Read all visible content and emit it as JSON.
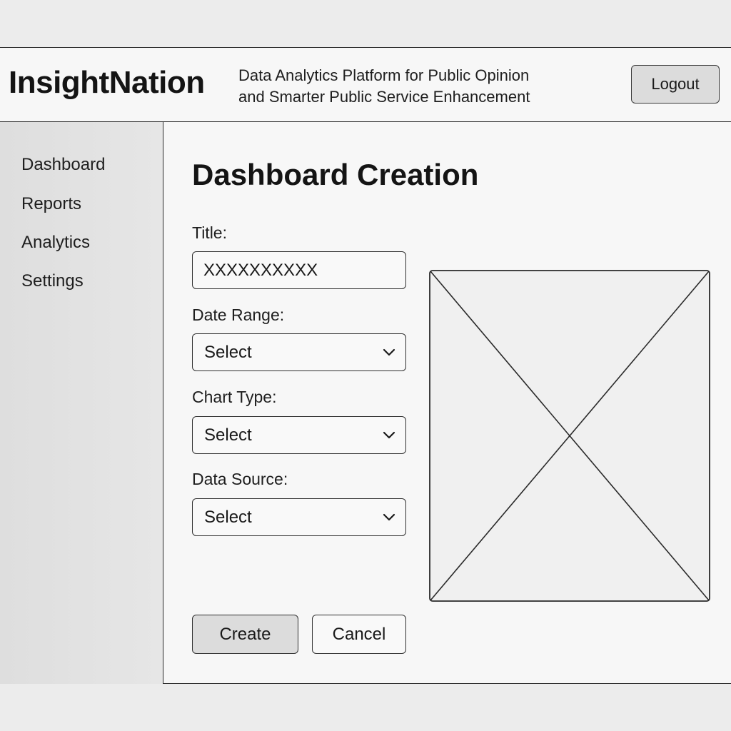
{
  "header": {
    "brand": "InsightNation",
    "tagline_line1": "Data Analytics Platform for Public Opinion",
    "tagline_line2": "and Smarter Public Service Enhancement",
    "logout_label": "Logout"
  },
  "sidebar": {
    "items": [
      {
        "label": "Dashboard"
      },
      {
        "label": "Reports"
      },
      {
        "label": "Analytics"
      },
      {
        "label": "Settings"
      }
    ]
  },
  "main": {
    "page_title": "Dashboard Creation",
    "form": {
      "title_label": "Title:",
      "title_value": "XXXXXXXXXX",
      "date_range_label": "Date Range:",
      "date_range_value": "Select",
      "chart_type_label": "Chart Type:",
      "chart_type_value": "Select",
      "data_source_label": "Data Source:",
      "data_source_value": "Select"
    },
    "buttons": {
      "create_label": "Create",
      "cancel_label": "Cancel"
    },
    "icons": {
      "dropdown": "chevron-down-icon",
      "preview": "image-placeholder-icon"
    }
  }
}
